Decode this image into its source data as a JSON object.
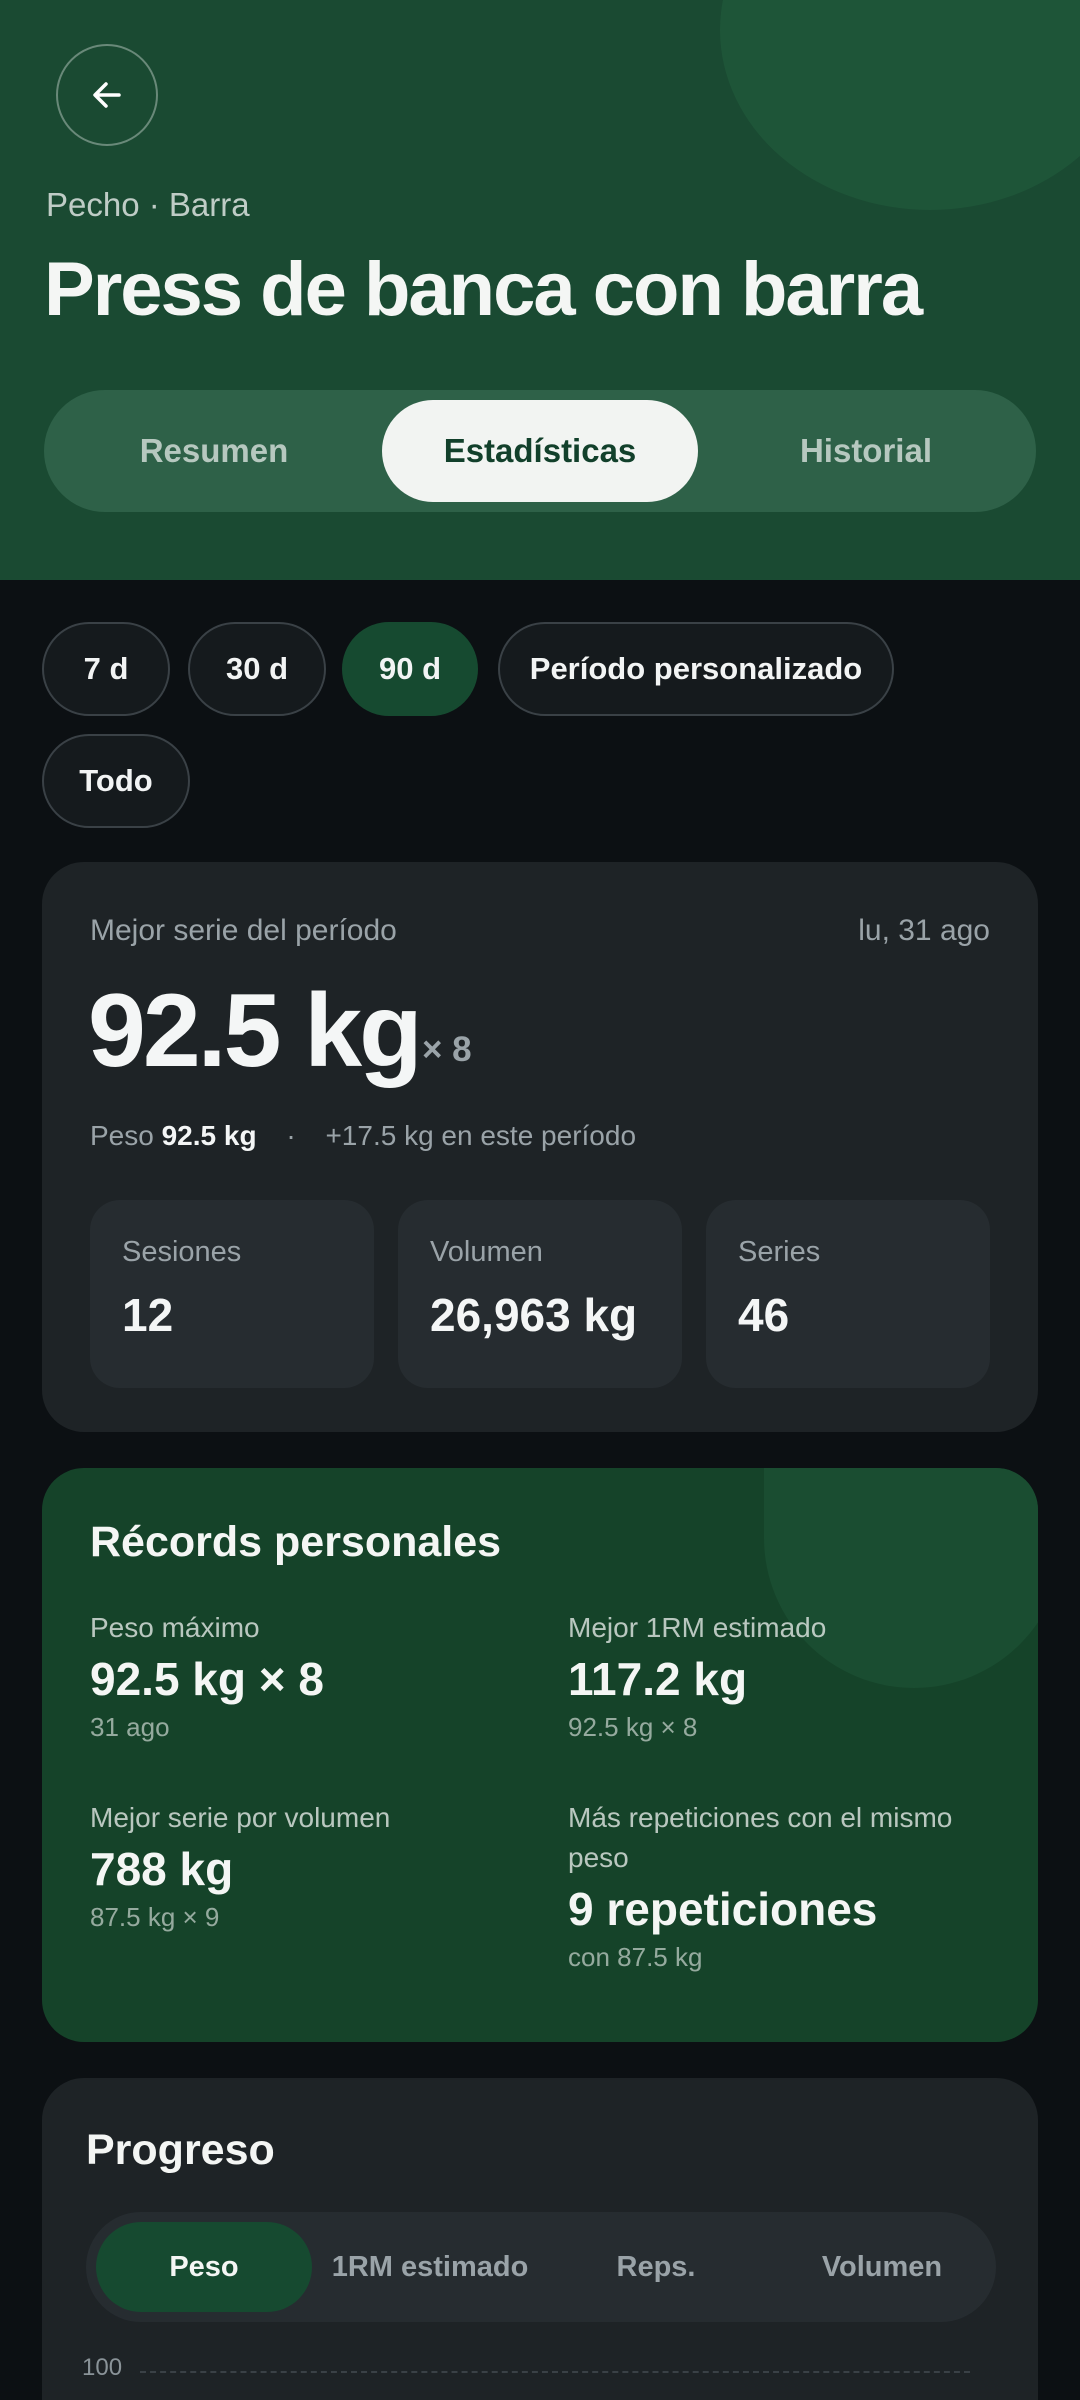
{
  "header": {
    "back_icon": "arrow-left-icon",
    "subtitle": "Pecho · Barra",
    "title": "Press de banca con barra",
    "tabs": [
      {
        "label": "Resumen",
        "active": false
      },
      {
        "label": "Estadísticas",
        "active": true
      },
      {
        "label": "Historial",
        "active": false
      }
    ]
  },
  "periods": {
    "chips": [
      {
        "label": "7 d",
        "active": false
      },
      {
        "label": "30 d",
        "active": false
      },
      {
        "label": "90 d",
        "active": true
      },
      {
        "label": "Período personalizado",
        "active": false
      },
      {
        "label": "Todo",
        "active": false
      }
    ]
  },
  "best_set": {
    "label": "Mejor serie del período",
    "date": "lu, 31 ago",
    "value": "92.5 kg",
    "reps": "× 8",
    "weight_label": "Peso",
    "weight_value": "92.5 kg",
    "separator": "·",
    "change": "+17.5 kg en este período",
    "stats": [
      {
        "label": "Sesiones",
        "value": "12"
      },
      {
        "label": "Volumen",
        "value": "26,963 kg"
      },
      {
        "label": "Series",
        "value": "46"
      }
    ]
  },
  "records": {
    "title": "Récords personales",
    "items": [
      {
        "label": "Peso máximo",
        "value": "92.5 kg × 8",
        "sub": "31 ago"
      },
      {
        "label": "Mejor 1RM estimado",
        "value": "117.2 kg",
        "sub": "92.5 kg × 8"
      },
      {
        "label": "Mejor serie por volumen",
        "value": "788 kg",
        "sub": "87.5 kg × 9"
      },
      {
        "label": "Más repeticiones con el mismo peso",
        "value": "9 repeticiones",
        "sub": "con 87.5 kg"
      }
    ]
  },
  "progress": {
    "title": "Progreso",
    "tabs": [
      {
        "label": "Peso",
        "active": true
      },
      {
        "label": "1RM estimado",
        "active": false
      },
      {
        "label": "Reps.",
        "active": false
      },
      {
        "label": "Volumen",
        "active": false
      }
    ],
    "y_tick_top": "100"
  },
  "colors": {
    "header_bg": "#1a4a32",
    "page_bg": "#0c1013",
    "card_bg": "#1e2326",
    "accent_green": "#164a30",
    "records_bg": "#154329"
  }
}
